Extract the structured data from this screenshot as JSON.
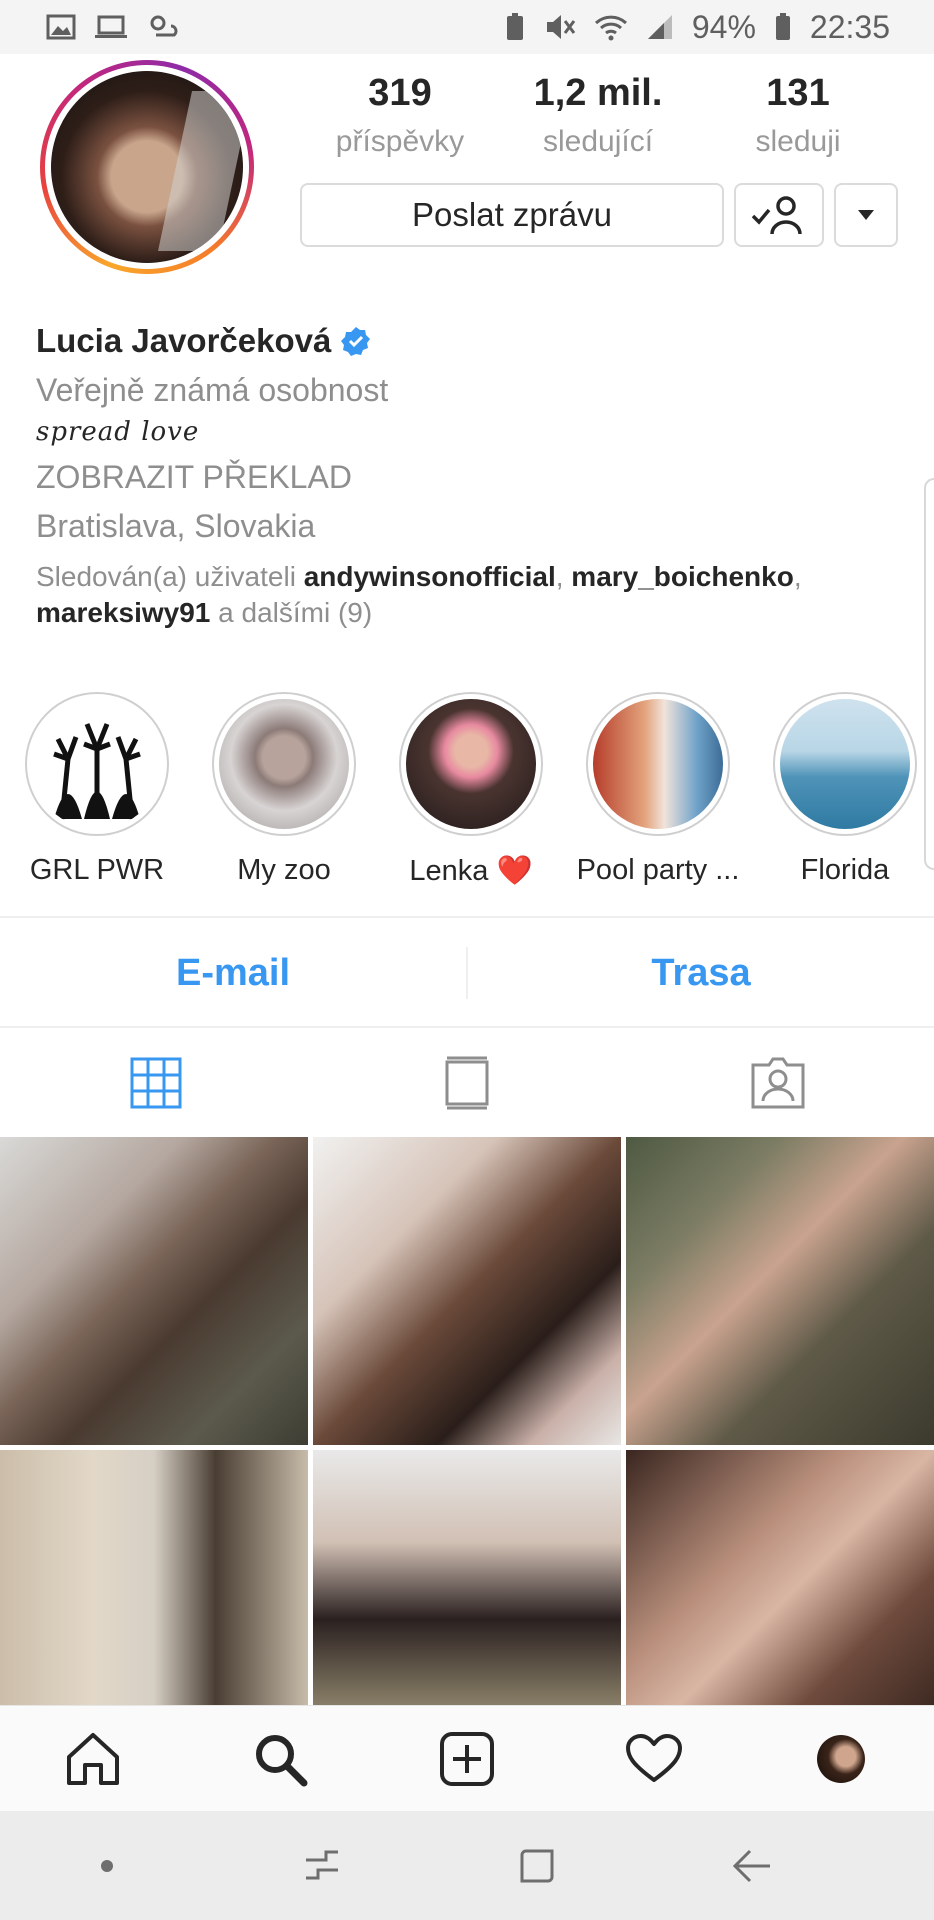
{
  "status_bar": {
    "battery": "94%",
    "time": "22:35"
  },
  "profile": {
    "stats": [
      {
        "value": "319",
        "label": "příspěvky"
      },
      {
        "value": "1,2 mil.",
        "label": "sledující"
      },
      {
        "value": "131",
        "label": "sleduji"
      }
    ],
    "message_button": "Poslat zprávu",
    "name": "Lucia Javorčeková",
    "category": "Veřejně známá osobnost",
    "bio_text": "spread love",
    "translate_link": "ZOBRAZIT PŘEKLAD",
    "location": "Bratislava, Slovakia",
    "followed_by": {
      "prefix": "Sledován(a) uživateli ",
      "user1": "andywinsonofficial",
      "sep1": ", ",
      "user2": "mary_boichenko",
      "sep2": ",",
      "user3": "mareksiwy91",
      "suffix": " a dalšími (9)"
    }
  },
  "highlights": [
    {
      "label": "GRL PWR"
    },
    {
      "label": "My zoo"
    },
    {
      "label": "Lenka ❤️"
    },
    {
      "label": "Pool party ..."
    },
    {
      "label": "Florida"
    }
  ],
  "contact": {
    "email": "E-mail",
    "directions": "Trasa"
  },
  "colors": {
    "accent": "#3897f0",
    "verified": "#3897f0"
  },
  "tabs": [
    "grid-icon",
    "feed-icon",
    "tagged-icon"
  ],
  "bottom_nav": [
    "home-icon",
    "search-icon",
    "add-icon",
    "heart-icon",
    "profile-avatar"
  ]
}
